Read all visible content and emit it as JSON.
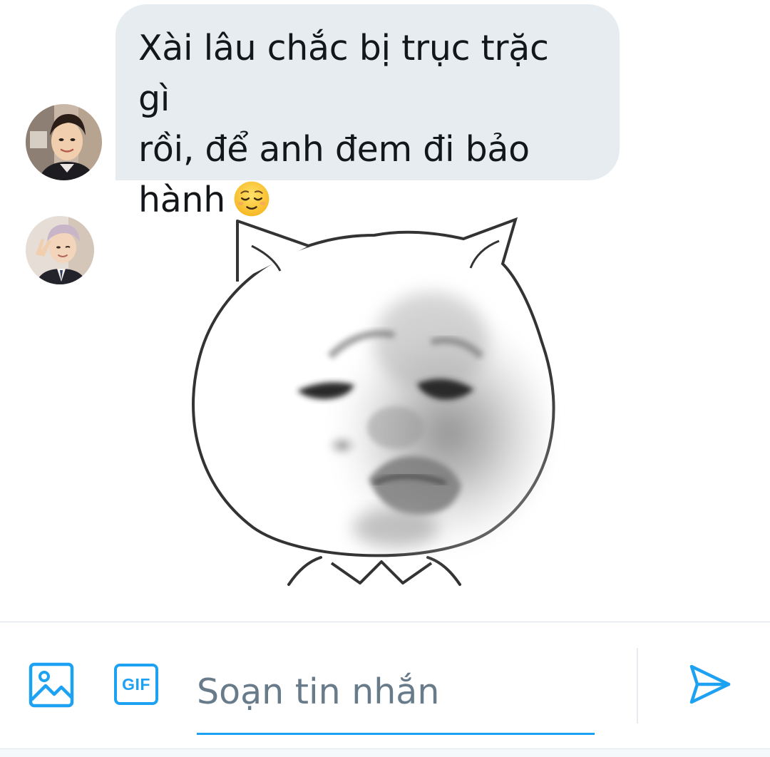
{
  "conversation": {
    "messages": [
      {
        "type": "text",
        "lines": [
          "Xài lâu chắc bị trục trặc gì",
          "rồi, để anh đem đi bảo",
          "hành"
        ],
        "emoji": "relieved-face-emoji"
      },
      {
        "type": "sticker",
        "sticker": "crying-cat-face-meme-sticker"
      }
    ],
    "avatars": [
      "avatar-photo",
      "avatar-photo"
    ]
  },
  "composer": {
    "placeholder": "Soạn tin nhắn",
    "value": "",
    "gif_label": "GIF",
    "icons": [
      "image-icon",
      "gif-icon",
      "send-icon"
    ]
  },
  "colors": {
    "accent": "#1da1f2",
    "bubble": "#e6ecf0",
    "text": "#14171a",
    "placeholder": "#687b8a"
  }
}
